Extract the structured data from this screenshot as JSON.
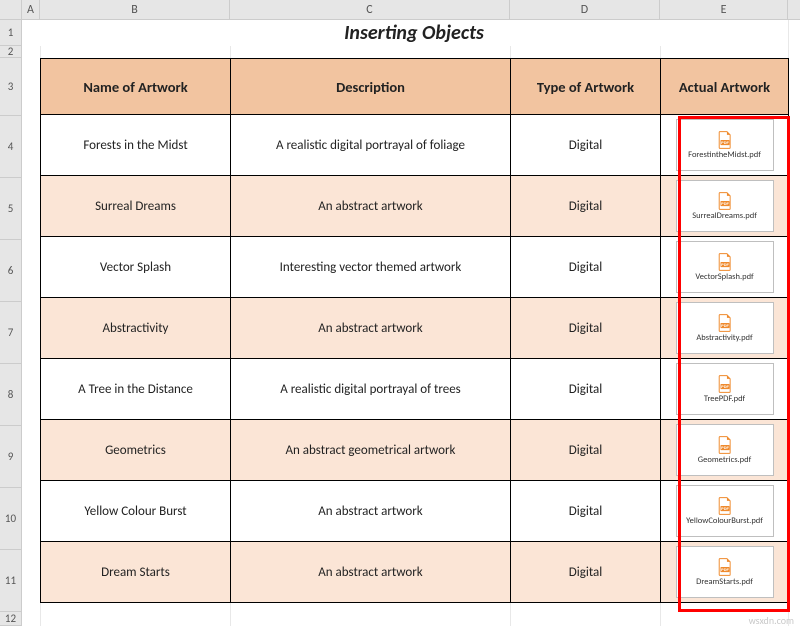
{
  "columns": {
    "A": "A",
    "B": "B",
    "C": "C",
    "D": "D",
    "E": "E"
  },
  "row_numbers": [
    "1",
    "2",
    "3",
    "4",
    "5",
    "6",
    "7",
    "8",
    "9",
    "10",
    "11",
    "12"
  ],
  "title": "Inserting Objects",
  "headers": {
    "name": "Name of Artwork",
    "desc": "Description",
    "type": "Type of Artwork",
    "actual": "Actual Artwork"
  },
  "rows": [
    {
      "name": "Forests in the Midst",
      "desc": "A realistic digital portrayal of  foliage",
      "type": "Digital",
      "file": "ForestintheMidst.pdf"
    },
    {
      "name": "Surreal Dreams",
      "desc": "An abstract artwork",
      "type": "Digital",
      "file": "SurrealDreams.pdf"
    },
    {
      "name": "Vector Splash",
      "desc": "Interesting vector themed artwork",
      "type": "Digital",
      "file": "VectorSplash.pdf"
    },
    {
      "name": "Abstractivity",
      "desc": "An abstract artwork",
      "type": "Digital",
      "file": "Abstractivity.pdf"
    },
    {
      "name": "A Tree in the Distance",
      "desc": "A realistic digital portrayal of trees",
      "type": "Digital",
      "file": "TreePDF.pdf"
    },
    {
      "name": "Geometrics",
      "desc": "An abstract geometrical artwork",
      "type": "Digital",
      "file": "Geometrics.pdf"
    },
    {
      "name": "Yellow Colour Burst",
      "desc": "An abstract artwork",
      "type": "Digital",
      "file": "YellowColourBurst.pdf"
    },
    {
      "name": "Dream Starts",
      "desc": "An abstract artwork",
      "type": "Digital",
      "file": "DreamStarts.pdf"
    }
  ],
  "watermark": "wsxdn.com",
  "icon_label": "PDF",
  "colors": {
    "header_fill": "#f2c4a0",
    "alt_fill": "#fbe5d6",
    "selection": "#ff0000",
    "pdf_orange": "#ef8a2d"
  }
}
